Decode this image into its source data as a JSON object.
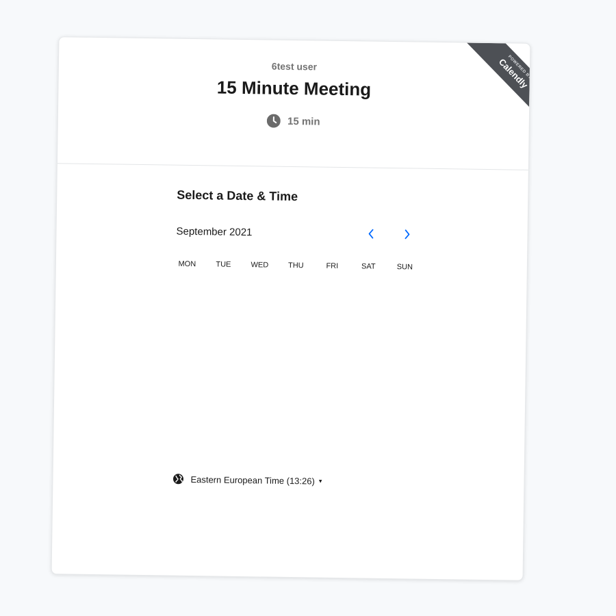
{
  "event": {
    "host": "6test user",
    "title": "15 Minute Meeting",
    "duration": "15 min"
  },
  "branding": {
    "powered_by": "POWERED BY",
    "brand": "Calendly",
    "ribbon_color": "#4d5055"
  },
  "scheduler": {
    "title": "Select a Date & Time",
    "month": "September 2021",
    "prev_icon": "chevron-left-icon",
    "next_icon": "chevron-right-icon",
    "weekdays": [
      "MON",
      "TUE",
      "WED",
      "THU",
      "FRI",
      "SAT",
      "SUN"
    ]
  },
  "timezone": {
    "label": "Eastern European Time (13:26)",
    "icon": "globe-icon",
    "caret": "▾"
  },
  "colors": {
    "accent": "#0069ff",
    "muted_text": "#737373",
    "background": "#f7f9fb"
  }
}
